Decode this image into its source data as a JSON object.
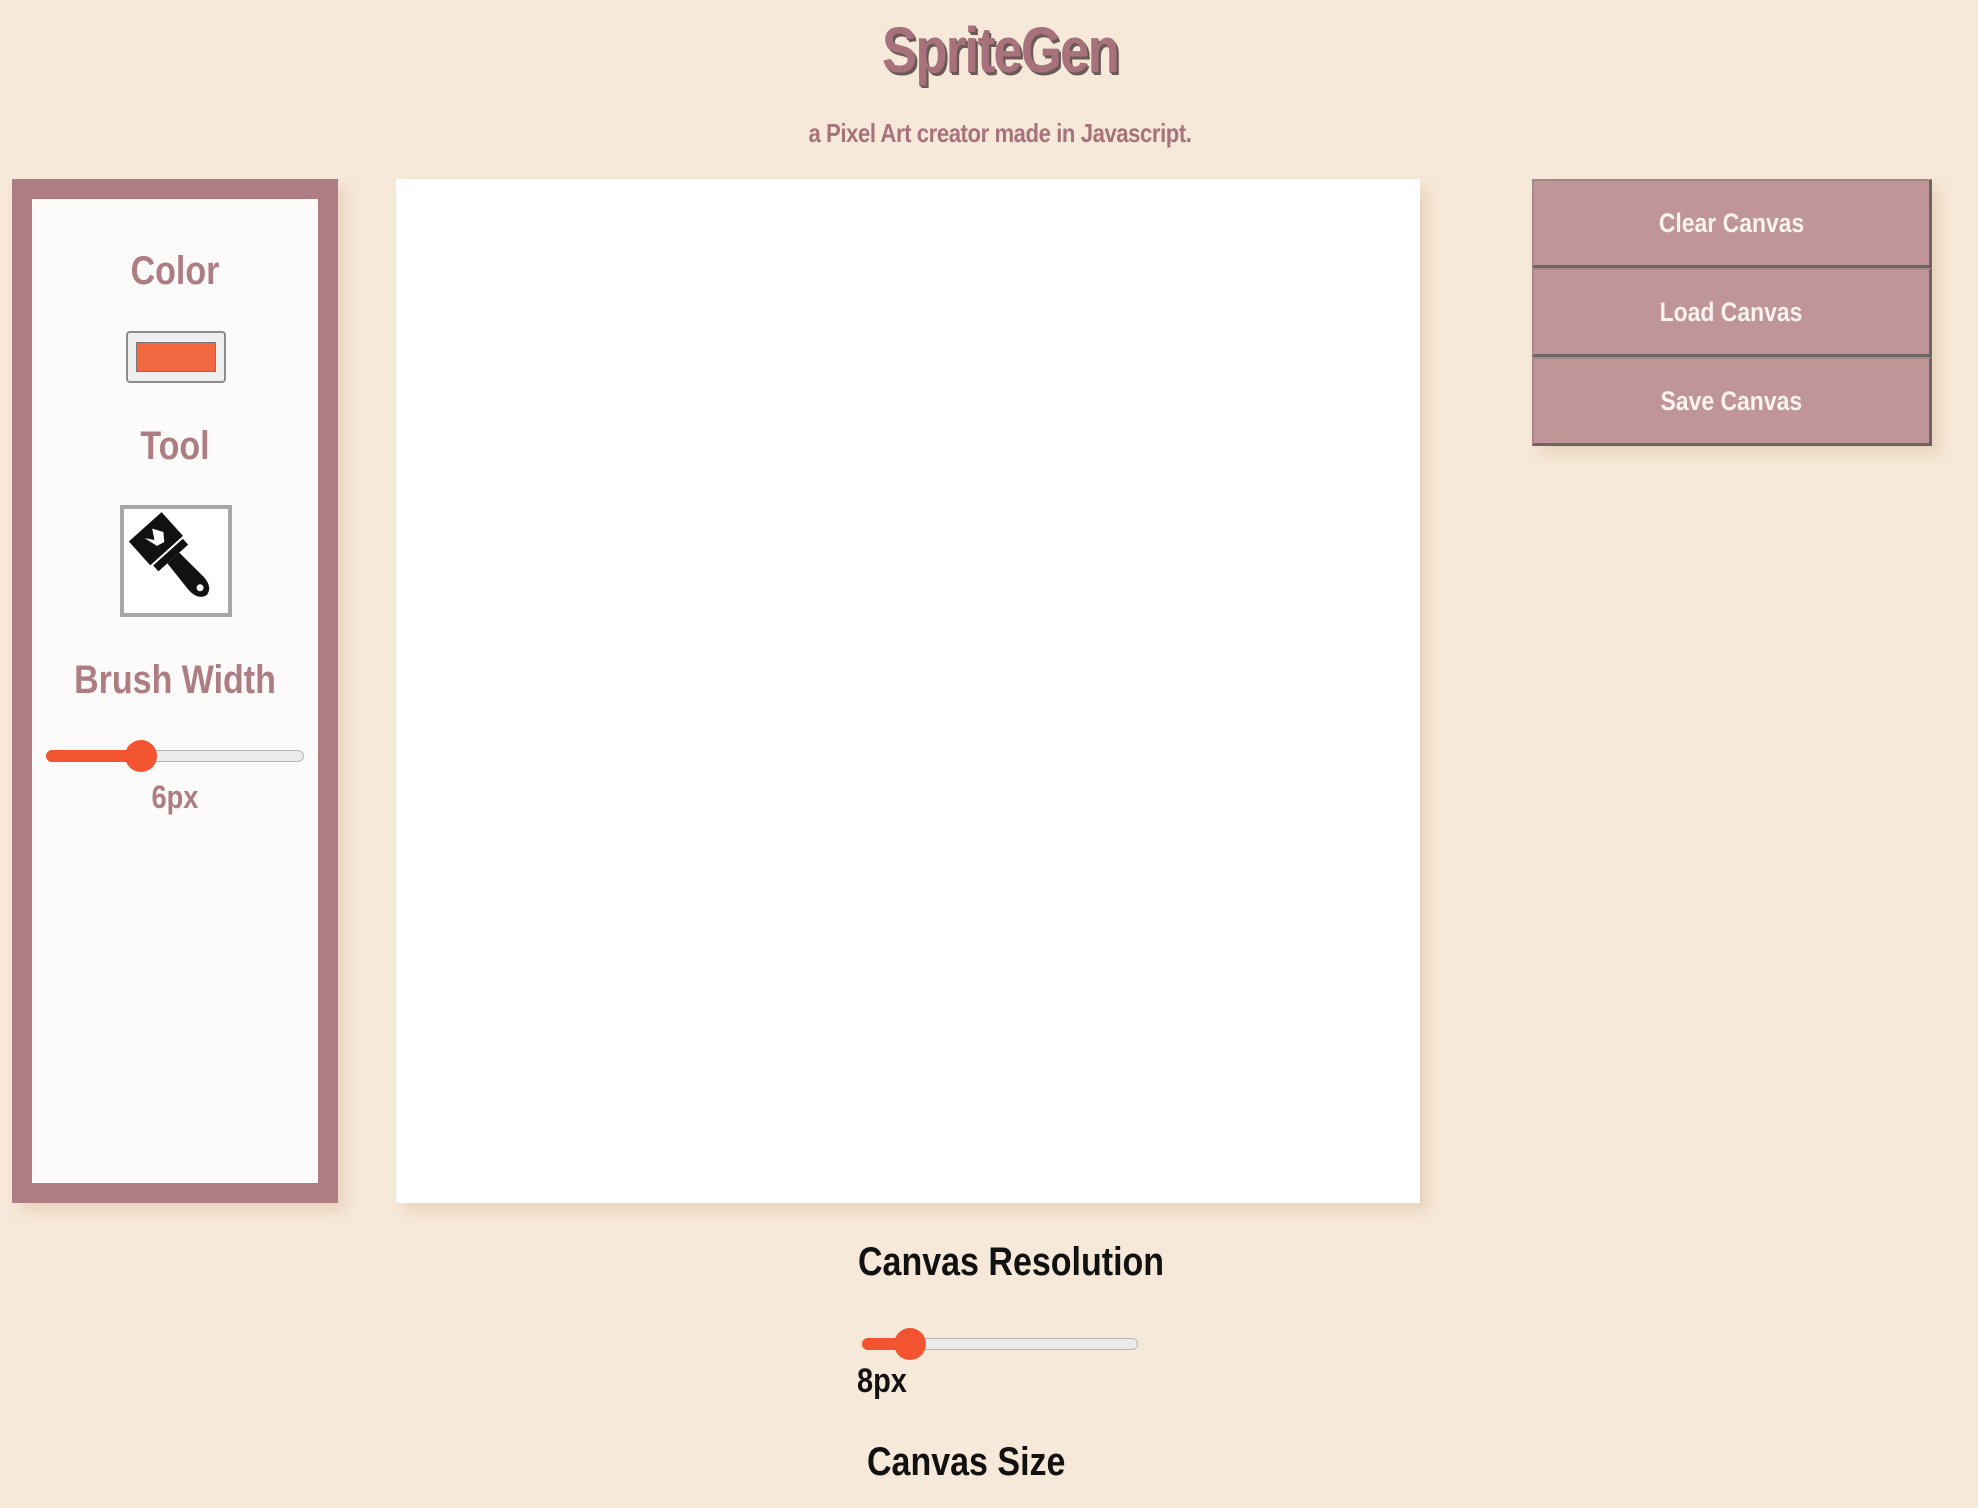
{
  "header": {
    "title": "SpriteGen",
    "subtitle": "a Pixel Art creator made in Javascript."
  },
  "toolbar": {
    "color_label": "Color",
    "selected_color": "#f26841",
    "tool_label": "Tool",
    "tool_icon": "paint-brush-icon",
    "brush_width_label": "Brush Width",
    "brush_width_value": "6px",
    "brush_width_fraction": 0.35
  },
  "actions": {
    "clear_label": "Clear Canvas",
    "load_label": "Load Canvas",
    "save_label": "Save Canvas"
  },
  "canvas_settings": {
    "resolution_label": "Canvas Resolution",
    "resolution_value": "8px",
    "resolution_fraction": 0.13,
    "size_label": "Canvas Size"
  },
  "colors": {
    "background": "#f7e9d9",
    "accent": "#ad7d83",
    "button": "#bf9597",
    "slider": "#f25432"
  }
}
